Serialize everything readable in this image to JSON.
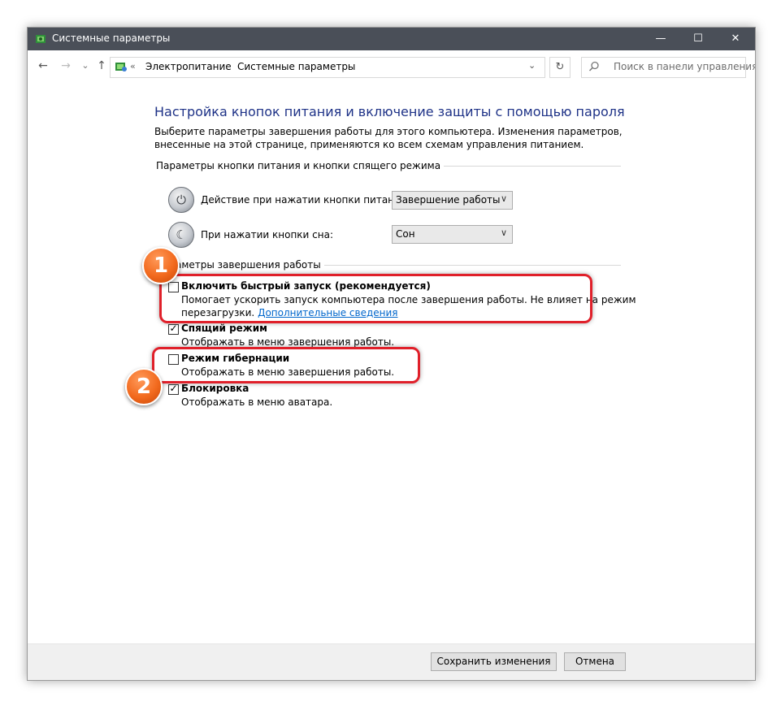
{
  "window": {
    "title": "Системные параметры",
    "controls": {
      "minimize": "—",
      "maximize": "☐",
      "close": "✕"
    }
  },
  "nav": {
    "back": "←",
    "forward": "→",
    "recent": "⌄",
    "up": "↑",
    "breadcrumb": [
      "Электропитание",
      "Системные параметры"
    ],
    "separator": "›",
    "overflow": "«",
    "dropdown": "⌄",
    "refresh": "↻",
    "search_placeholder": "Поиск в панели управления"
  },
  "main": {
    "heading": "Настройка кнопок питания и включение защиты с помощью пароля",
    "description": "Выберите параметры завершения работы для этого компьютера. Изменения параметров, внесенные на этой странице, применяются ко всем схемам управления питанием.",
    "buttons_section": {
      "title": "Параметры кнопки питания и кнопки спящего режима",
      "rows": [
        {
          "label": "Действие при нажатии кнопки питания:",
          "value": "Завершение работы",
          "icon": "power-button-icon"
        },
        {
          "label": "При нажатии кнопки сна:",
          "value": "Сон",
          "icon": "sleep-button-icon"
        }
      ]
    },
    "shutdown_section": {
      "title": "Параметры завершения работы",
      "options": [
        {
          "title": "Включить быстрый запуск (рекомендуется)",
          "checked": false,
          "desc_line1": "Помогает ускорить запуск компьютера после завершения работы. Не влияет на режим",
          "desc_line2": "перезагрузки.",
          "link": "Дополнительные сведения"
        },
        {
          "title": "Спящий режим",
          "checked": true,
          "desc": "Отображать в меню завершения работы."
        },
        {
          "title": "Режим гибернации",
          "checked": false,
          "desc": "Отображать в меню завершения работы."
        },
        {
          "title": "Блокировка",
          "checked": true,
          "desc": "Отображать в меню аватара."
        }
      ]
    }
  },
  "footer": {
    "save": "Сохранить изменения",
    "cancel": "Отмена"
  },
  "annotations": {
    "badge1": "1",
    "badge2": "2",
    "callout_color": "#e0202a",
    "badge_color": "#f26a1e"
  },
  "checkmark": "✓"
}
